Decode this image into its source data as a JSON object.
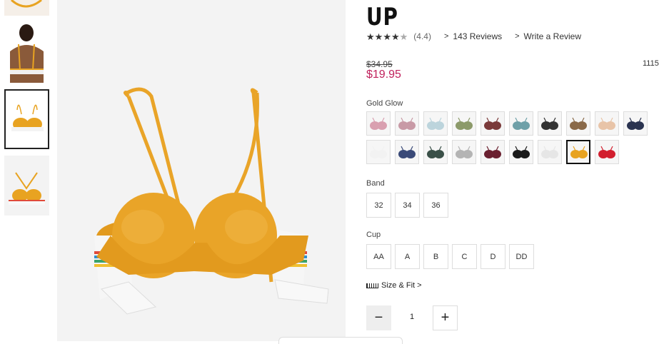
{
  "product": {
    "title": "UP",
    "rating_value": "(4.4)",
    "stars": 4.5,
    "reviews_link": "143 Reviews",
    "write_review_link": "Write a Review",
    "old_price": "$34.95",
    "new_price": "$19.95",
    "sku_partial": "1115"
  },
  "colors": {
    "selected_label": "Gold Glow",
    "accent_price": "#c0215c",
    "swatches": [
      {
        "name": "pink-print",
        "color": "#d9a0b0"
      },
      {
        "name": "mauve-pink",
        "color": "#c89aa6"
      },
      {
        "name": "light-blue-print",
        "color": "#bcd4dc"
      },
      {
        "name": "olive",
        "color": "#8c9a6a"
      },
      {
        "name": "burgundy-brown",
        "color": "#7a3a3a"
      },
      {
        "name": "teal-print",
        "color": "#6fa0a8"
      },
      {
        "name": "black-print",
        "color": "#333333"
      },
      {
        "name": "leopard",
        "color": "#8a6a4a"
      },
      {
        "name": "nude",
        "color": "#e8c4a8"
      },
      {
        "name": "navy-print",
        "color": "#2a3350"
      },
      {
        "name": "white",
        "color": "#f2f2f2"
      },
      {
        "name": "navy",
        "color": "#3a4a78"
      },
      {
        "name": "dark-green-print",
        "color": "#3a5048"
      },
      {
        "name": "grey",
        "color": "#b4b4b4"
      },
      {
        "name": "wine",
        "color": "#6a2030"
      },
      {
        "name": "black",
        "color": "#1a1a1a"
      },
      {
        "name": "white-print",
        "color": "#e6e6e6"
      },
      {
        "name": "gold-glow",
        "color": "#e8a321"
      },
      {
        "name": "red",
        "color": "#d21f2f"
      }
    ]
  },
  "band": {
    "label": "Band",
    "options": [
      "32",
      "34",
      "36"
    ]
  },
  "cup": {
    "label": "Cup",
    "options": [
      "AA",
      "A",
      "B",
      "C",
      "D",
      "DD"
    ]
  },
  "size_fit": {
    "label": "Size & Fit",
    "icon": "ruler-icon"
  },
  "quantity": {
    "minus": "−",
    "value": "1",
    "plus": "+"
  },
  "images": {
    "main_color": "#e8a321"
  }
}
